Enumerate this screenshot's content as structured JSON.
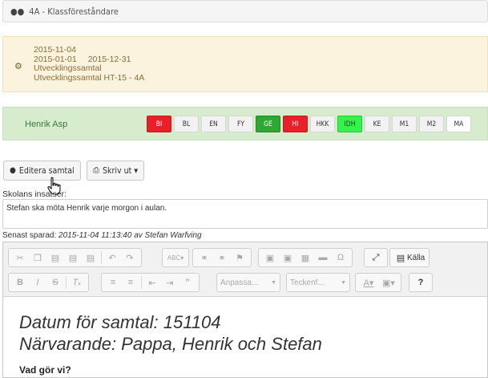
{
  "header": {
    "icon": "group-icon",
    "title": "4A - Klassföreståndare"
  },
  "info": {
    "icon": "dashboard-icon",
    "date": "2015-11-04",
    "period_start": "2015-01-01",
    "period_end": "2015-12-31",
    "type": "Utvecklingssamtal",
    "name": "Utvecklingssamtal HT-15 - 4A"
  },
  "student": {
    "name": "Henrik Asp",
    "subjects": [
      {
        "label": "BI",
        "status": "red"
      },
      {
        "label": "BL",
        "status": "neutral"
      },
      {
        "label": "EN",
        "status": "neutral"
      },
      {
        "label": "FY",
        "status": "neutral"
      },
      {
        "label": "GE",
        "status": "green"
      },
      {
        "label": "HI",
        "status": "red"
      },
      {
        "label": "HKK",
        "status": "neutral"
      },
      {
        "label": "IDH",
        "status": "lime"
      },
      {
        "label": "KE",
        "status": "neutral"
      },
      {
        "label": "M1",
        "status": "neutral"
      },
      {
        "label": "M2",
        "status": "neutral"
      },
      {
        "label": "MA",
        "status": "white"
      }
    ],
    "colors": {
      "red": "#e8202a",
      "green": "#2fa733",
      "lime": "#34f34a"
    }
  },
  "actions": {
    "edit_label": "Editera samtal",
    "edit_icon": "globe-icon",
    "print_label": "Skriv ut",
    "print_icon": "printer-icon"
  },
  "insatser": {
    "label": "Skolans insatser:",
    "value": "Stefan ska möta Henrik varje morgon i aulan."
  },
  "saved": {
    "prefix": "Senast sparad:",
    "info": "2015-11-04 11:13:40 av Stefan Warfving"
  },
  "editor": {
    "source_label": "Källa",
    "format_placeholder": "Anpassa...",
    "font_placeholder": "Teckenf...",
    "content": {
      "line1": "Datum för samtal: 151104",
      "line2": "Närvarande: Pappa, Henrik och Stefan",
      "line3": "Vad gör vi?"
    }
  }
}
